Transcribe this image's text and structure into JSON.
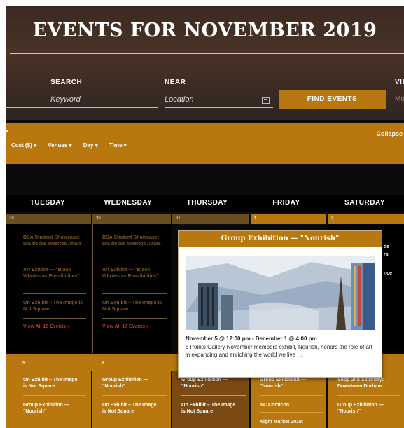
{
  "page": {
    "title": "EVENTS FOR NOVEMBER 2019",
    "collapse_label": "Collapse"
  },
  "search_bar": {
    "search_label": "SEARCH",
    "keyword_placeholder": "Keyword",
    "near_label": "NEAR",
    "location_placeholder": "Location",
    "find_button": "FIND EVENTS",
    "view_label_partial": "VIE",
    "view_value_partial": "Mo"
  },
  "filters": {
    "items": [
      "Cost ($) ▾",
      "Venues ▾",
      "Day ▾",
      "Time ▾"
    ]
  },
  "calendar": {
    "day_headers": [
      "TUESDAY",
      "WEDNESDAY",
      "THURSDAY",
      "FRIDAY",
      "SATURDAY"
    ],
    "week1": {
      "dates": [
        "29",
        "30",
        "31",
        "1",
        "2"
      ],
      "tuesday_events": [
        "DSA Student Showcase: Dia de los Muertos Altars",
        "Art Exhibit — \"Black Wholes as Possibilities\"",
        "On Exhibit – The Image is Not Square"
      ],
      "tuesday_view_all": "View All 15 Events »",
      "wednesday_events": [
        "DSA Student Showcase: Dia de los Muertos Altars",
        "Art Exhibit — \"Black Wholes as Possibilities\"",
        "On Exhibit – The Image is Not Square"
      ],
      "wednesday_view_all": "View All 17 Events »",
      "saturday_partials": [
        "de",
        "rs",
        "nce"
      ]
    },
    "week2": {
      "dates": [
        "5",
        "6"
      ],
      "tuesday_events": [
        "On Exhibit – The Image is Not Square",
        "Group Exhibition — \"Nourish\""
      ],
      "wednesday_events": [
        "Group Exhibition — \"Nourish\"",
        "On Exhibit – The Image is Not Square"
      ],
      "thursday_events": [
        "Group Exhibition — \"Nourish\"",
        "On Exhibit – The Image is Not Square"
      ],
      "friday_events": [
        "Group Exhibition — \"Nourish\"",
        "NC Comicon",
        "Night Market 2019:"
      ],
      "saturday_events": [
        "Shop 2nd Saturday: Downtown Durham",
        "Group Exhibition — \"Nourish\""
      ]
    }
  },
  "popup": {
    "title": "Group Exhibition — \"Nourish\"",
    "date_range": "November 5 @ 12:00 pm - December 1 @ 4:00 pm",
    "description": "5 Points Gallery November members exhibit, Nourish, honors the role of art in expanding and enriching the world we live …"
  },
  "colors": {
    "accent": "#b8780f",
    "background": "#0b0b0b",
    "link_red": "#b23a2a"
  }
}
